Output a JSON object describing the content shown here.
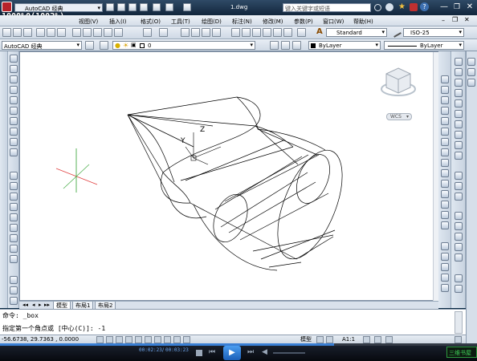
{
  "title_bar": {
    "workspace": "AutoCAD 经典",
    "file": "1.dwg",
    "search_placeholder": "键入关键字或短语",
    "overlay_text": "1000%0(1002%)"
  },
  "menu": [
    "视图(V)",
    "插入(I)",
    "格式(O)",
    "工具(T)",
    "绘图(D)",
    "标注(N)",
    "修改(M)",
    "参数(P)",
    "窗口(W)",
    "帮助(H)"
  ],
  "toolbar1": {
    "text_style": "Standard",
    "dim_style": "ISO-25"
  },
  "toolbar2": {
    "workspace": "AutoCAD 经典",
    "layer": "0",
    "color": "ByLayer",
    "linetype": "ByLayer"
  },
  "viewcube": {
    "label": "WCS"
  },
  "ucs": {
    "y_label": "Y",
    "z_label": "Z"
  },
  "layout_tabs": [
    "模型",
    "布局1",
    "布局2"
  ],
  "command": {
    "line1": "命令: _box",
    "line2": "指定第一个角点或 [中心(C)]: -1"
  },
  "status": {
    "coords": "-56.6738, 29.7363 , 0.0000",
    "model_label": "模型",
    "scale": "A1:1"
  },
  "player": {
    "time_current": "00:02:23",
    "time_total": "00:03:23",
    "watermark": "三维书屋"
  },
  "colors": {
    "title_bg": "#12263c",
    "canvas_bg": "#ffffff",
    "player_bg": "#07090e",
    "accent_green": "#2e9a3e"
  }
}
